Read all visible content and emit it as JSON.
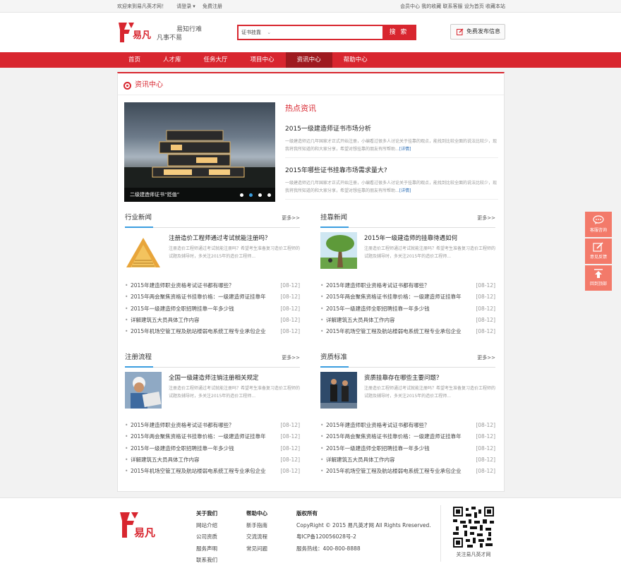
{
  "topbar": {
    "welcome": "欢迎来到易凡英才网！",
    "login": "请登录",
    "register": "免费注册",
    "links": [
      "会员中心",
      "我的收藏",
      "联系客服",
      "设为首页",
      "收藏本站"
    ]
  },
  "header": {
    "logo_text": "易凡",
    "slogan": "易知行难 凡事不易",
    "search_scope": "证书挂靠",
    "search_button": "搜 索",
    "publish_button": "免费发布信息"
  },
  "nav": {
    "items": [
      "首页",
      "人才库",
      "任务大厅",
      "项目中心",
      "资讯中心",
      "帮助中心"
    ],
    "active": "资讯中心"
  },
  "main": {
    "title": "资讯中心",
    "banner_caption": "二级建造师证书“贬值”",
    "hot": {
      "heading": "热点资讯",
      "articles": [
        {
          "title": "2015一级建造师证书市场分析",
          "desc": "一级建造师迈几年国家才正式开始注册，小编看过很多人讨论关于挂靠的观点，能找到比较全面的说法比较少，现我将我所知道的和大家分享，希望对想挂靠的朋友有所帮助...",
          "more": "[详情]"
        },
        {
          "title": "2015年哪些证书挂靠市场需求量大?",
          "desc": "一级建造师迈几年国家才正式开始注册，小编看过很多人讨论关于挂靠的观点，能找到比较全面的说法比较少，现我将我所知道的和大家分享，希望对想挂靠的朋友有所帮助...",
          "more": "[详情]"
        }
      ]
    },
    "sections": [
      {
        "heading": "行业新闻",
        "more": "更多>>",
        "feature_title": "注册造价工程师通过考试就能注册吗？",
        "feature_desc": "注册造价工程师通过考试就能注册吗？希望考生准备复习造价工程师的试题及辅导时，多关注2015年的造价工程师...",
        "items": [
          {
            "text": "2015年建造师职业资格考试证书都有哪些？",
            "date": "[08-12]"
          },
          {
            "text": "2015年两会聚焦资格证书挂靠价格：一级建造师证挂靠年",
            "date": "[08-12]"
          },
          {
            "text": "2015年一级建造师全职招聘挂靠一年多少钱",
            "date": "[08-12]"
          },
          {
            "text": "详解建筑五大员具体工作内容",
            "date": "[08-12]"
          },
          {
            "text": "2015年机场空管工程及航站楼弱电系统工程专业承包企业",
            "date": "[08-12]"
          }
        ]
      },
      {
        "heading": "挂靠新闻",
        "more": "更多>>",
        "feature_title": "2015年一级建造师的挂靠待遇如何",
        "feature_desc": "注册造价工程师通过考试就能注册吗？希望考生准备复习造价工程师的试题及辅导时，多关注2015年的造价工程师...",
        "items": [
          {
            "text": "2015年建造师职业资格考试证书都有哪些？",
            "date": "[08-12]"
          },
          {
            "text": "2015年两会聚焦资格证书挂靠价格：一级建造师证挂靠年",
            "date": "[08-12]"
          },
          {
            "text": "2015年一级建造师全职招聘挂靠一年多少钱",
            "date": "[08-12]"
          },
          {
            "text": "详解建筑五大员具体工作内容",
            "date": "[08-12]"
          },
          {
            "text": "2015年机场空管工程及航站楼弱电系统工程专业承包企业",
            "date": "[08-12]"
          }
        ]
      },
      {
        "heading": "注册流程",
        "more": "更多>>",
        "feature_title": "全国一级建造师注销注册相关规定",
        "feature_desc": "注册造价工程师通过考试就能注册吗？希望考生准备复习造价工程师的试题及辅导时，多关注2015年的造价工程师...",
        "items": [
          {
            "text": "2015年建造师职业资格考试证书都有哪些？",
            "date": "[08-12]"
          },
          {
            "text": "2015年两会聚焦资格证书挂靠价格：一级建造师证挂靠年",
            "date": "[08-12]"
          },
          {
            "text": "2015年一级建造师全职招聘挂靠一年多少钱",
            "date": "[08-12]"
          },
          {
            "text": "详解建筑五大员具体工作内容",
            "date": "[08-12]"
          },
          {
            "text": "2015年机场空管工程及航站楼弱电系统工程专业承包企业",
            "date": "[08-12]"
          }
        ]
      },
      {
        "heading": "资质标准",
        "more": "更多>>",
        "feature_title": "资质挂靠存在哪些主要问题？",
        "feature_desc": "注册造价工程师通过考试就能注册吗？希望考生准备复习造价工程师的试题及辅导时，多关注2015年的造价工程师...",
        "items": [
          {
            "text": "2015年建造师职业资格考试证书都有哪些？",
            "date": "[08-12]"
          },
          {
            "text": "2015年两会聚焦资格证书挂靠价格：一级建造师证挂靠年",
            "date": "[08-12]"
          },
          {
            "text": "2015年一级建造师全职招聘挂靠一年多少钱",
            "date": "[08-12]"
          },
          {
            "text": "详解建筑五大员具体工作内容",
            "date": "[08-12]"
          },
          {
            "text": "2015年机场空管工程及航站楼弱电系统工程专业承包企业",
            "date": "[08-12]"
          }
        ]
      }
    ]
  },
  "float": {
    "items": [
      "客服咨询",
      "意见反馈",
      "回到顶部"
    ]
  },
  "footer": {
    "about": {
      "heading": "关于我们",
      "links": [
        "网站介绍",
        "公司资质",
        "服务声明",
        "联系我们"
      ]
    },
    "help": {
      "heading": "帮助中心",
      "links": [
        "新手指南",
        "交流流程",
        "常见问题"
      ]
    },
    "copyright": {
      "heading": "版权所有",
      "lines": [
        "CopyRight © 2015 易凡英才网 All Rights Rreserved.",
        "粤ICP备120056028号-2",
        "服务热线：400-800-8888"
      ]
    },
    "qr_caption": "关注易凡英才网"
  },
  "colors": {
    "brand_red": "#d8262f",
    "nav_active": "#9e1a1f",
    "accent_blue": "#3b9ee0",
    "float_bg": "#f37a6a"
  }
}
